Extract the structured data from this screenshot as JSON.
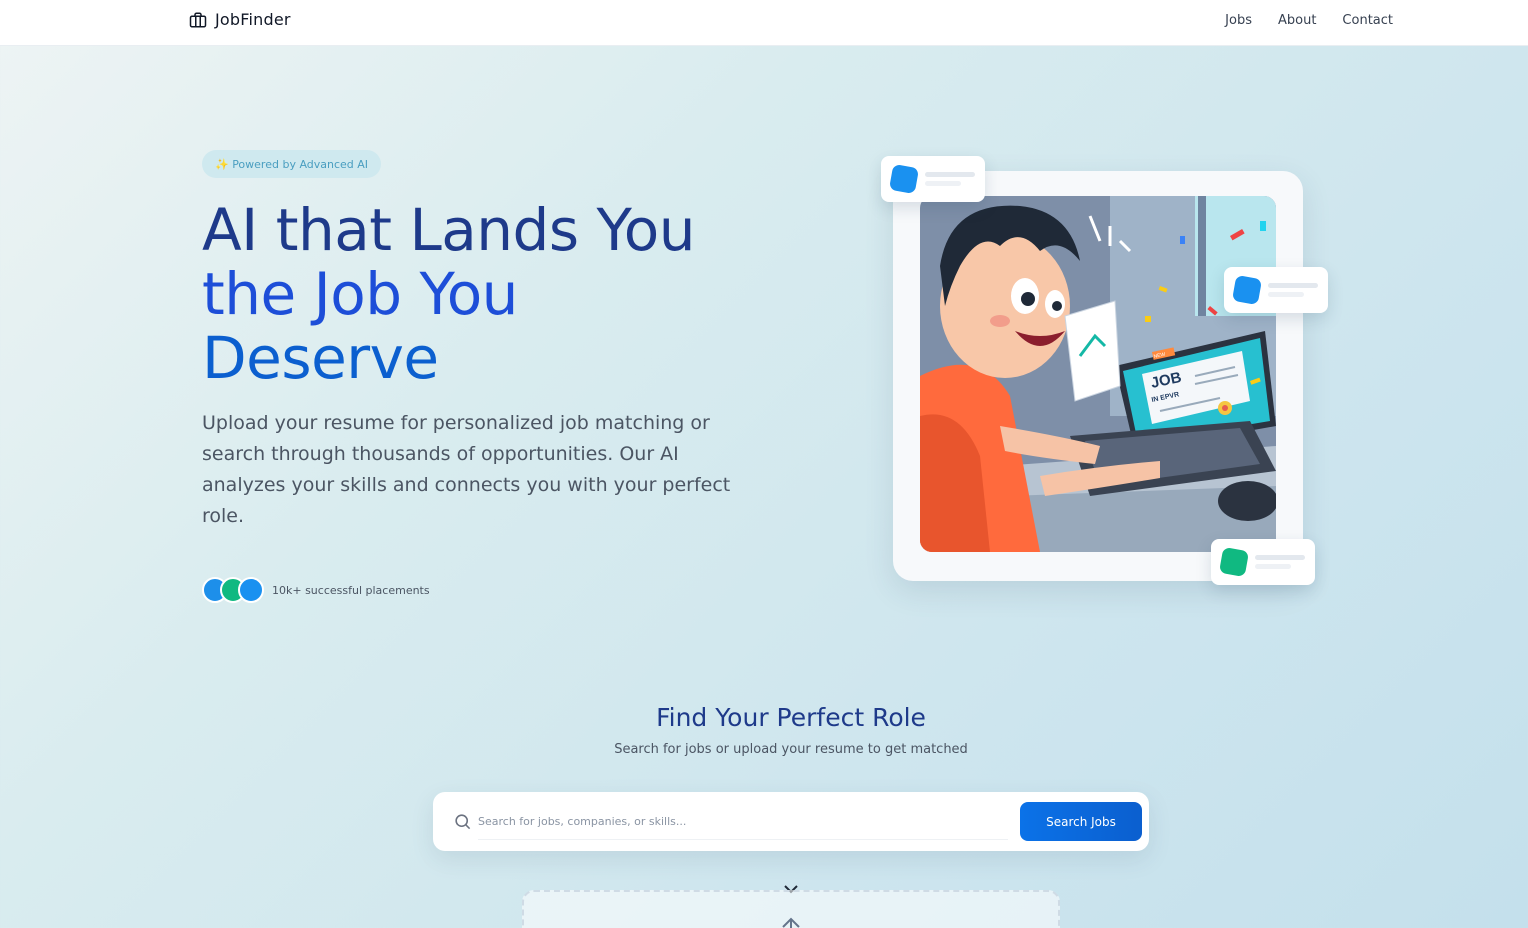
{
  "nav": {
    "brand": "JobFinder",
    "links": [
      "Jobs",
      "About",
      "Contact"
    ]
  },
  "hero": {
    "badge": "✨ Powered by Advanced AI",
    "title_line1": "AI that Lands You",
    "title_line2": "the Job You",
    "title_line3": "Deserve",
    "subtitle": "Upload your resume for personalized job matching or search through thousands of opportunities. Our AI analyzes your skills and connects you with your perfect role.",
    "placements": "10k+ successful placements",
    "illustration": {
      "screen_title": "JOB",
      "screen_subtitle": "IN EPVR",
      "screen_tag": "NEW"
    }
  },
  "search_section": {
    "title": "Find Your Perfect Role",
    "subtitle": "Search for jobs or upload your resume to get matched",
    "placeholder": "Search for jobs, companies, or skills...",
    "button": "Search Jobs"
  },
  "colors": {
    "primary": "#0b72e8",
    "title_dark": "#1e3a8a",
    "accent_green": "#10b981"
  },
  "icons": {
    "brand": "briefcase-icon",
    "search": "search-icon",
    "toggle": "chevron-down-icon",
    "upload": "upload-icon"
  }
}
